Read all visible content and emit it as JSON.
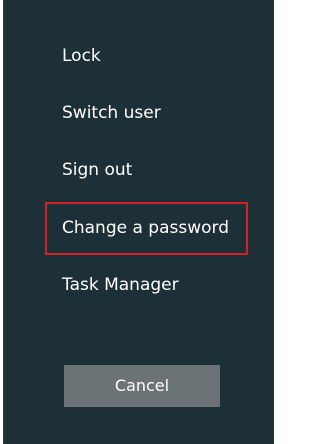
{
  "menu": {
    "items": [
      {
        "label": "Lock"
      },
      {
        "label": "Switch user"
      },
      {
        "label": "Sign out"
      },
      {
        "label": "Change a password"
      },
      {
        "label": "Task Manager"
      }
    ]
  },
  "actions": {
    "cancel_label": "Cancel"
  },
  "colors": {
    "panel_bg": "#1e3037",
    "text": "#ffffff",
    "highlight_border": "#d62027",
    "button_bg": "#6b7377"
  }
}
